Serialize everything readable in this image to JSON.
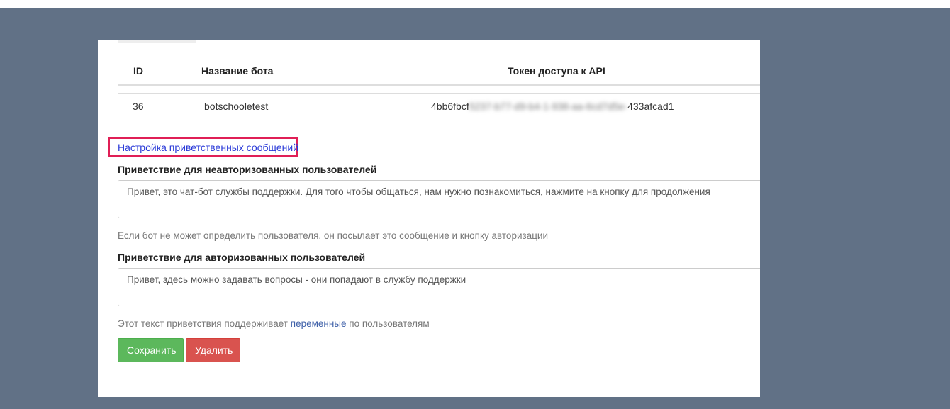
{
  "table": {
    "headers": {
      "id": "ID",
      "name": "Название бота",
      "token": "Токен доступа к API"
    },
    "rows": [
      {
        "id": "36",
        "name": "botschooletest",
        "token_visible_start": "4bb6fbcf",
        "token_hidden": "5237-b77-d9-b4-1-938-aa-6cd7d5e-",
        "token_visible_end": "433afcad1"
      }
    ]
  },
  "greetings": {
    "settings_link": "Настройка приветственных сообщений",
    "unauthorized": {
      "label": "Приветствие для неавторизованных пользователей",
      "value": "Привет, это чат-бот службы поддержки. Для того чтобы общаться, нам нужно познакомиться, нажмите на кнопку для продолжения",
      "help": "Если бот не может определить пользователя, он посылает это сообщение и кнопку авторизации"
    },
    "authorized": {
      "label": "Приветствие для авторизованных пользователей",
      "value": "Привет, здесь можно задавать вопросы - они попадают в службу поддержки"
    },
    "variables_help": {
      "before": "Этот текст приветствия поддерживает",
      "link": "переменные",
      "after": "по пользователям"
    }
  },
  "actions": {
    "save_label": "Сохранить",
    "delete_label": "Удалить"
  },
  "colors": {
    "backdrop": "#617186",
    "highlight_border": "#e01f56",
    "save_button": "#5cb85c",
    "delete_button": "#d9534f"
  }
}
